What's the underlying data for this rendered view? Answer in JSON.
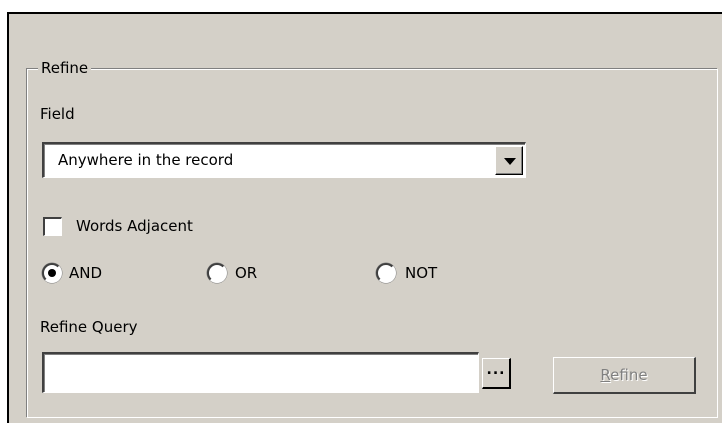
{
  "refine_group": {
    "title": "Refine",
    "field_label": "Field",
    "field_select": {
      "selected_value": "Anywhere in the record",
      "dropdown_icon": "chevron-down-icon"
    },
    "words_adjacent": {
      "label": "Words Adjacent",
      "checked": false
    },
    "operators": [
      {
        "label": "AND",
        "selected": true
      },
      {
        "label": "OR",
        "selected": false
      },
      {
        "label": "NOT",
        "selected": false
      }
    ],
    "query_label": "Refine Query",
    "query_input": {
      "value": "",
      "placeholder": ""
    },
    "browse_button_label": "...",
    "refine_button": {
      "label_mnemonic": "R",
      "label_rest": "efine",
      "enabled": false
    }
  }
}
